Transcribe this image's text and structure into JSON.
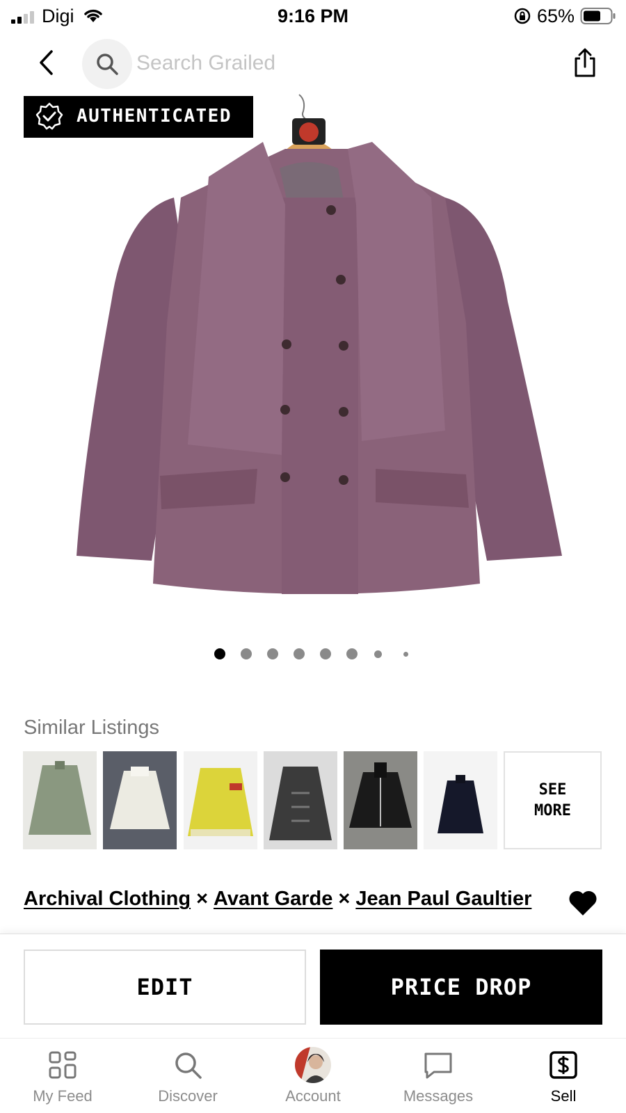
{
  "status_bar": {
    "carrier": "Digi",
    "time": "9:16 PM",
    "battery_percent": "65%",
    "battery_level": 0.65
  },
  "nav": {
    "search_placeholder": "Search Grailed",
    "icons": [
      "chevron-left-icon",
      "search-icon",
      "share-icon"
    ]
  },
  "product": {
    "badge_label": "AUTHENTICATED",
    "image_count": 8,
    "current_image": 1
  },
  "similar": {
    "title": "Similar Listings",
    "see_more_label": "SEE MORE",
    "thumb_count": 6
  },
  "listing": {
    "designers": [
      "Archival Clothing",
      "Avant Garde",
      "Jean Paul Gaultier"
    ],
    "separator": "×"
  },
  "actions": {
    "edit_label": "EDIT",
    "price_drop_label": "PRICE DROP"
  },
  "tabbar": {
    "tabs": [
      {
        "label": "My Feed",
        "icon": "feed-grid-icon"
      },
      {
        "label": "Discover",
        "icon": "search-icon"
      },
      {
        "label": "Account",
        "icon": "avatar"
      },
      {
        "label": "Messages",
        "icon": "chat-bubble-icon"
      },
      {
        "label": "Sell",
        "icon": "dollar-box-icon"
      }
    ],
    "active": "Sell"
  }
}
